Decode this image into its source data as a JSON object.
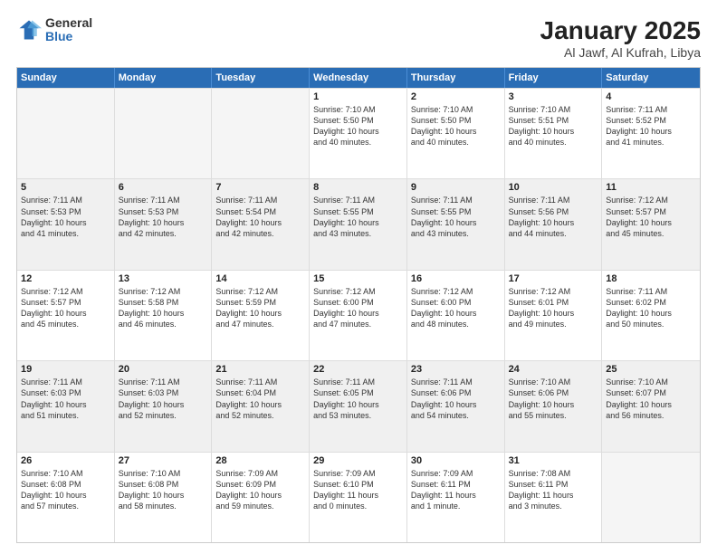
{
  "logo": {
    "general": "General",
    "blue": "Blue"
  },
  "title": "January 2025",
  "subtitle": "Al Jawf, Al Kufrah, Libya",
  "days": [
    "Sunday",
    "Monday",
    "Tuesday",
    "Wednesday",
    "Thursday",
    "Friday",
    "Saturday"
  ],
  "rows": [
    [
      {
        "day": "",
        "lines": [],
        "empty": true
      },
      {
        "day": "",
        "lines": [],
        "empty": true
      },
      {
        "day": "",
        "lines": [],
        "empty": true
      },
      {
        "day": "1",
        "lines": [
          "Sunrise: 7:10 AM",
          "Sunset: 5:50 PM",
          "Daylight: 10 hours",
          "and 40 minutes."
        ]
      },
      {
        "day": "2",
        "lines": [
          "Sunrise: 7:10 AM",
          "Sunset: 5:50 PM",
          "Daylight: 10 hours",
          "and 40 minutes."
        ]
      },
      {
        "day": "3",
        "lines": [
          "Sunrise: 7:10 AM",
          "Sunset: 5:51 PM",
          "Daylight: 10 hours",
          "and 40 minutes."
        ]
      },
      {
        "day": "4",
        "lines": [
          "Sunrise: 7:11 AM",
          "Sunset: 5:52 PM",
          "Daylight: 10 hours",
          "and 41 minutes."
        ]
      }
    ],
    [
      {
        "day": "5",
        "lines": [
          "Sunrise: 7:11 AM",
          "Sunset: 5:53 PM",
          "Daylight: 10 hours",
          "and 41 minutes."
        ],
        "shaded": true
      },
      {
        "day": "6",
        "lines": [
          "Sunrise: 7:11 AM",
          "Sunset: 5:53 PM",
          "Daylight: 10 hours",
          "and 42 minutes."
        ],
        "shaded": true
      },
      {
        "day": "7",
        "lines": [
          "Sunrise: 7:11 AM",
          "Sunset: 5:54 PM",
          "Daylight: 10 hours",
          "and 42 minutes."
        ],
        "shaded": true
      },
      {
        "day": "8",
        "lines": [
          "Sunrise: 7:11 AM",
          "Sunset: 5:55 PM",
          "Daylight: 10 hours",
          "and 43 minutes."
        ],
        "shaded": true
      },
      {
        "day": "9",
        "lines": [
          "Sunrise: 7:11 AM",
          "Sunset: 5:55 PM",
          "Daylight: 10 hours",
          "and 43 minutes."
        ],
        "shaded": true
      },
      {
        "day": "10",
        "lines": [
          "Sunrise: 7:11 AM",
          "Sunset: 5:56 PM",
          "Daylight: 10 hours",
          "and 44 minutes."
        ],
        "shaded": true
      },
      {
        "day": "11",
        "lines": [
          "Sunrise: 7:12 AM",
          "Sunset: 5:57 PM",
          "Daylight: 10 hours",
          "and 45 minutes."
        ],
        "shaded": true
      }
    ],
    [
      {
        "day": "12",
        "lines": [
          "Sunrise: 7:12 AM",
          "Sunset: 5:57 PM",
          "Daylight: 10 hours",
          "and 45 minutes."
        ]
      },
      {
        "day": "13",
        "lines": [
          "Sunrise: 7:12 AM",
          "Sunset: 5:58 PM",
          "Daylight: 10 hours",
          "and 46 minutes."
        ]
      },
      {
        "day": "14",
        "lines": [
          "Sunrise: 7:12 AM",
          "Sunset: 5:59 PM",
          "Daylight: 10 hours",
          "and 47 minutes."
        ]
      },
      {
        "day": "15",
        "lines": [
          "Sunrise: 7:12 AM",
          "Sunset: 6:00 PM",
          "Daylight: 10 hours",
          "and 47 minutes."
        ]
      },
      {
        "day": "16",
        "lines": [
          "Sunrise: 7:12 AM",
          "Sunset: 6:00 PM",
          "Daylight: 10 hours",
          "and 48 minutes."
        ]
      },
      {
        "day": "17",
        "lines": [
          "Sunrise: 7:12 AM",
          "Sunset: 6:01 PM",
          "Daylight: 10 hours",
          "and 49 minutes."
        ]
      },
      {
        "day": "18",
        "lines": [
          "Sunrise: 7:11 AM",
          "Sunset: 6:02 PM",
          "Daylight: 10 hours",
          "and 50 minutes."
        ]
      }
    ],
    [
      {
        "day": "19",
        "lines": [
          "Sunrise: 7:11 AM",
          "Sunset: 6:03 PM",
          "Daylight: 10 hours",
          "and 51 minutes."
        ],
        "shaded": true
      },
      {
        "day": "20",
        "lines": [
          "Sunrise: 7:11 AM",
          "Sunset: 6:03 PM",
          "Daylight: 10 hours",
          "and 52 minutes."
        ],
        "shaded": true
      },
      {
        "day": "21",
        "lines": [
          "Sunrise: 7:11 AM",
          "Sunset: 6:04 PM",
          "Daylight: 10 hours",
          "and 52 minutes."
        ],
        "shaded": true
      },
      {
        "day": "22",
        "lines": [
          "Sunrise: 7:11 AM",
          "Sunset: 6:05 PM",
          "Daylight: 10 hours",
          "and 53 minutes."
        ],
        "shaded": true
      },
      {
        "day": "23",
        "lines": [
          "Sunrise: 7:11 AM",
          "Sunset: 6:06 PM",
          "Daylight: 10 hours",
          "and 54 minutes."
        ],
        "shaded": true
      },
      {
        "day": "24",
        "lines": [
          "Sunrise: 7:10 AM",
          "Sunset: 6:06 PM",
          "Daylight: 10 hours",
          "and 55 minutes."
        ],
        "shaded": true
      },
      {
        "day": "25",
        "lines": [
          "Sunrise: 7:10 AM",
          "Sunset: 6:07 PM",
          "Daylight: 10 hours",
          "and 56 minutes."
        ],
        "shaded": true
      }
    ],
    [
      {
        "day": "26",
        "lines": [
          "Sunrise: 7:10 AM",
          "Sunset: 6:08 PM",
          "Daylight: 10 hours",
          "and 57 minutes."
        ]
      },
      {
        "day": "27",
        "lines": [
          "Sunrise: 7:10 AM",
          "Sunset: 6:08 PM",
          "Daylight: 10 hours",
          "and 58 minutes."
        ]
      },
      {
        "day": "28",
        "lines": [
          "Sunrise: 7:09 AM",
          "Sunset: 6:09 PM",
          "Daylight: 10 hours",
          "and 59 minutes."
        ]
      },
      {
        "day": "29",
        "lines": [
          "Sunrise: 7:09 AM",
          "Sunset: 6:10 PM",
          "Daylight: 11 hours",
          "and 0 minutes."
        ]
      },
      {
        "day": "30",
        "lines": [
          "Sunrise: 7:09 AM",
          "Sunset: 6:11 PM",
          "Daylight: 11 hours",
          "and 1 minute."
        ]
      },
      {
        "day": "31",
        "lines": [
          "Sunrise: 7:08 AM",
          "Sunset: 6:11 PM",
          "Daylight: 11 hours",
          "and 3 minutes."
        ]
      },
      {
        "day": "",
        "lines": [],
        "empty": true
      }
    ]
  ]
}
